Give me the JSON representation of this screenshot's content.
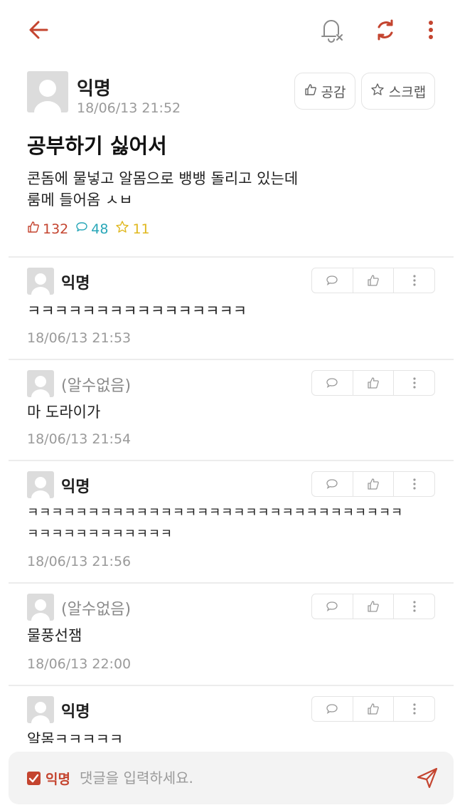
{
  "post": {
    "author": "익명",
    "time": "18/06/13 21:52",
    "like_button": "공감",
    "scrap_button": "스크랩",
    "title": "공부하기 싫어서",
    "body_line1": "콘돔에 물넣고 알몸으로 뱅뱅 돌리고 있는데",
    "body_line2": "룸메 들어옴 ㅅㅂ",
    "likes": "132",
    "comments": "48",
    "scraps": "11"
  },
  "comments": [
    {
      "author": "익명",
      "text": "ㅋㅋㅋㅋㅋㅋㅋㅋㅋㅋㅋㅋㅋㅋㅋㅋ",
      "time": "18/06/13 21:53"
    },
    {
      "author": "(알수없음)",
      "text": "마 도라이가",
      "time": "18/06/13 21:54"
    },
    {
      "author": "익명",
      "text": "ㅋㅋㅋㅋㅋㅋㅋㅋㅋㅋㅋㅋㅋㅋㅋㅋㅋㅋㅋㅋㅋㅋㅋㅋㅋㅋㅋㅋㅋㅋㅋ",
      "text2": "ㅋㅋㅋㅋㅋㅋㅋㅋㅋㅋㅋㅋ",
      "time": "18/06/13 21:56"
    },
    {
      "author": "(알수없음)",
      "text": "물풍선잼",
      "time": "18/06/13 22:00"
    },
    {
      "author": "익명",
      "text": "알몸ㅋㅋㅋㅋㅋ"
    }
  ],
  "input": {
    "anon_label": "익명",
    "placeholder": "댓글을 입력하세요."
  },
  "colors": {
    "accent": "#c4442f",
    "comment_stat": "#29a7b8",
    "scrap_stat": "#e0b81f"
  }
}
